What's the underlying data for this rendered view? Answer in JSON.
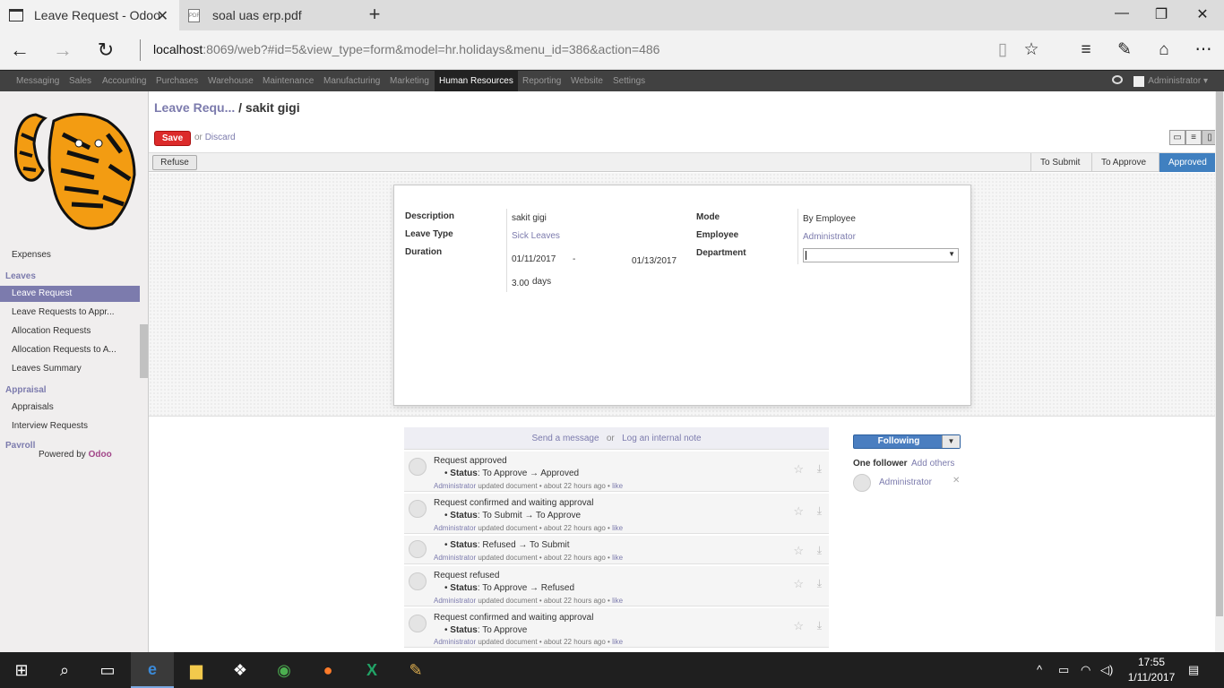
{
  "browser": {
    "tabs": [
      {
        "title": "Leave Request - Odoo"
      },
      {
        "title": "soal uas erp.pdf"
      }
    ],
    "url_host": "localhost",
    "url_rest": ":8069/web?#id=5&view_type=form&model=hr.holidays&menu_id=386&action=486"
  },
  "topmenu": {
    "items": [
      "Messaging",
      "Sales",
      "Accounting",
      "Purchases",
      "Warehouse",
      "Maintenance",
      "Manufacturing",
      "Marketing",
      "Human Resources",
      "Reporting",
      "Website",
      "Settings"
    ],
    "active": "Human Resources",
    "user": "Administrator"
  },
  "sidebar": {
    "expenses": "Expenses",
    "leaves_head": "Leaves",
    "leave_items": [
      "Leave Request",
      "Leave Requests to Appr...",
      "Allocation Requests",
      "Allocation Requests to A...",
      "Leaves Summary"
    ],
    "appraisal_head": "Appraisal",
    "appraisal_items": [
      "Appraisals",
      "Interview Requests"
    ],
    "payroll_head": "Payroll",
    "powered_by": "Powered by",
    "powered_brand": "Odoo"
  },
  "breadcrumb": {
    "parent": "Leave Requ...",
    "current": "/ sakit gigi"
  },
  "actions": {
    "save": "Save",
    "or": "or",
    "discard": "Discard",
    "refuse": "Refuse"
  },
  "stages": [
    "To Submit",
    "To Approve",
    "Approved"
  ],
  "current_stage": "Approved",
  "form": {
    "description_label": "Description",
    "description": "sakit gigi",
    "leave_type_label": "Leave Type",
    "leave_type": "Sick Leaves",
    "duration_label": "Duration",
    "date_from": "01/11/2017",
    "date_dash": "-",
    "date_to": "01/13/2017",
    "days_value": "3.00",
    "days_unit": "days",
    "mode_label": "Mode",
    "mode": "By Employee",
    "employee_label": "Employee",
    "employee": "Administrator",
    "department_label": "Department",
    "department": ""
  },
  "chatter": {
    "send_message": "Send a message",
    "or": "or",
    "log_note": "Log an internal note",
    "messages": [
      {
        "title": "Request approved",
        "status_label": "Status",
        "status": ": To Approve → Approved",
        "author": "Administrator",
        "meta": " updated document • about 22 hours ago • ",
        "like": "like"
      },
      {
        "title": "Request confirmed and waiting approval",
        "status_label": "Status",
        "status": ": To Submit → To Approve",
        "author": "Administrator",
        "meta": " updated document • about 22 hours ago • ",
        "like": "like"
      },
      {
        "title": "",
        "status_label": "Status",
        "status": ": Refused → To Submit",
        "author": "Administrator",
        "meta": " updated document • about 22 hours ago • ",
        "like": "like"
      },
      {
        "title": "Request refused",
        "status_label": "Status",
        "status": ": To Approve → Refused",
        "author": "Administrator",
        "meta": " updated document • about 22 hours ago • ",
        "like": "like"
      },
      {
        "title": "Request confirmed and waiting approval",
        "status_label": "Status",
        "status": ": To Approve",
        "author": "Administrator",
        "meta": " updated document • about 22 hours ago • ",
        "like": "like"
      }
    ],
    "following": "Following",
    "one_follower": "One follower",
    "add_others": "Add others",
    "follower_name": "Administrator"
  },
  "taskbar": {
    "time": "17:55",
    "date": "1/11/2017"
  },
  "colors": {
    "accent": "#7c7bad",
    "save": "#dc2a2a",
    "stage_active": "#4080c0",
    "topmenu": "#414141"
  }
}
